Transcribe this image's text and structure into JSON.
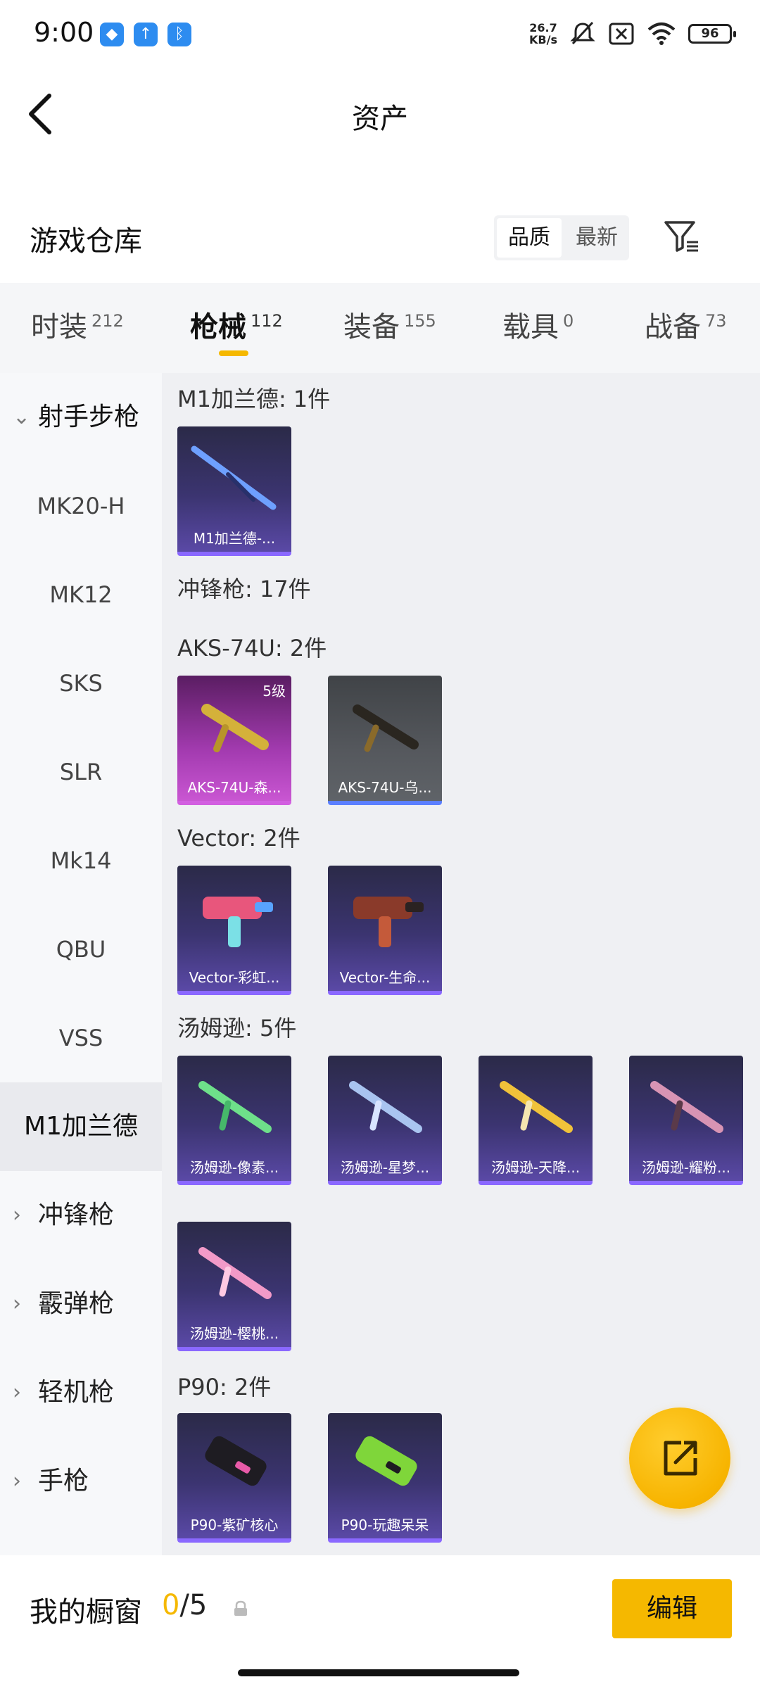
{
  "status_bar": {
    "time": "9:00",
    "net_speed_value": "26.7",
    "net_speed_unit": "KB/s",
    "battery": "96",
    "icons": [
      "app-notification-icon",
      "upload-icon",
      "bluetooth-icon",
      "mute-icon",
      "sim-icon",
      "wifi-icon",
      "battery-icon"
    ]
  },
  "header": {
    "title": "资产"
  },
  "warehouse": {
    "title": "游戏仓库",
    "sort_options": [
      "品质",
      "最新"
    ]
  },
  "tabs": [
    {
      "label": "时装",
      "count": "212"
    },
    {
      "label": "枪械",
      "count": "112"
    },
    {
      "label": "装备",
      "count": "155"
    },
    {
      "label": "载具",
      "count": "0"
    },
    {
      "label": "战备",
      "count": "73"
    }
  ],
  "sidebar": {
    "group_open": "射手步枪",
    "items": [
      "MK20-H",
      "MK12",
      "SKS",
      "SLR",
      "Mk14",
      "QBU",
      "VSS",
      "M1加兰德"
    ],
    "groups_closed": [
      "冲锋枪",
      "霰弹枪",
      "轻机枪",
      "手枪"
    ]
  },
  "content": {
    "sections": [
      {
        "title": "M1加兰德: 1件"
      },
      {
        "title": "冲锋枪: 17件"
      },
      {
        "title": "AKS-74U: 2件"
      },
      {
        "title": "Vector: 2件"
      },
      {
        "title": "汤姆逊: 5件"
      },
      {
        "title": "P90: 2件"
      }
    ],
    "cards": [
      {
        "label": "M1加兰德-...",
        "level": ""
      },
      {
        "label": "AKS-74U-森...",
        "level": "5级"
      },
      {
        "label": "AKS-74U-乌...",
        "level": ""
      },
      {
        "label": "Vector-彩虹...",
        "level": ""
      },
      {
        "label": "Vector-生命...",
        "level": ""
      },
      {
        "label": "汤姆逊-像素...",
        "level": ""
      },
      {
        "label": "汤姆逊-星梦...",
        "level": ""
      },
      {
        "label": "汤姆逊-天降...",
        "level": ""
      },
      {
        "label": "汤姆逊-耀粉...",
        "level": ""
      },
      {
        "label": "汤姆逊-樱桃...",
        "level": ""
      },
      {
        "label": "P90-紫矿核心",
        "level": ""
      },
      {
        "label": "P90-玩趣呆呆",
        "level": ""
      }
    ]
  },
  "bottom_bar": {
    "label": "我的橱窗",
    "used": "0",
    "total": "/5",
    "edit_label": "编辑"
  },
  "colors": {
    "accent": "#f5b800",
    "card_purple": "#3b3470",
    "card_pink": "#a33bb0",
    "card_grey": "#55585d"
  }
}
